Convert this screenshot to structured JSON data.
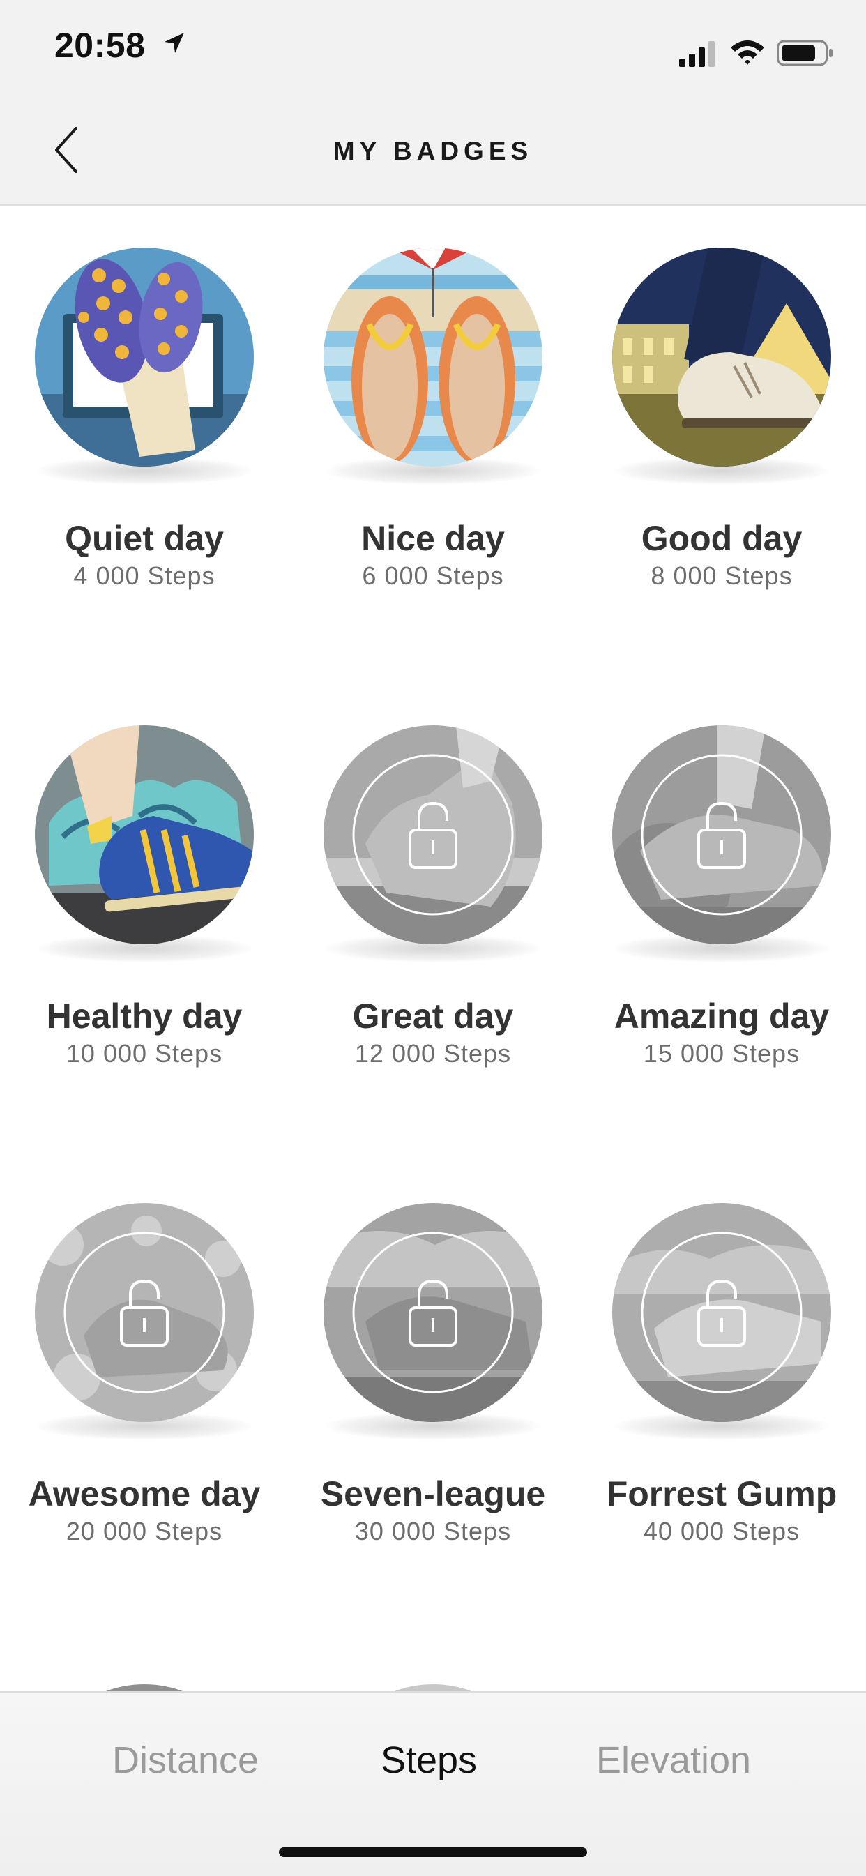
{
  "status_bar": {
    "time": "20:58",
    "icons": [
      "location-arrow-icon",
      "cellular-signal-icon",
      "wifi-icon",
      "battery-icon"
    ]
  },
  "header": {
    "title": "MY BADGES",
    "back_icon": "chevron-left-icon"
  },
  "badges": [
    {
      "name": "Quiet day",
      "steps": "4 000 Steps",
      "unlocked": true,
      "art": "slippers-computer"
    },
    {
      "name": "Nice day",
      "steps": "6 000 Steps",
      "unlocked": true,
      "art": "flip-flops-beach"
    },
    {
      "name": "Good day",
      "steps": "8 000 Steps",
      "unlocked": true,
      "art": "shoe-louvre-night"
    },
    {
      "name": "Healthy day",
      "steps": "10 000 Steps",
      "unlocked": true,
      "art": "sneaker-graffiti"
    },
    {
      "name": "Great day",
      "steps": "12 000 Steps",
      "unlocked": false,
      "art": "locked"
    },
    {
      "name": "Amazing day",
      "steps": "15 000 Steps",
      "unlocked": false,
      "art": "locked"
    },
    {
      "name": "Awesome day",
      "steps": "20 000 Steps",
      "unlocked": false,
      "art": "locked"
    },
    {
      "name": "Seven-league",
      "steps": "30 000 Steps",
      "unlocked": false,
      "art": "locked"
    },
    {
      "name": "Forrest Gump",
      "steps": "40 000 Steps",
      "unlocked": false,
      "art": "locked"
    }
  ],
  "tabs": [
    {
      "label": "Distance",
      "active": false
    },
    {
      "label": "Steps",
      "active": true
    },
    {
      "label": "Elevation",
      "active": false
    }
  ],
  "colors": {
    "header_bg": "#f2f2f2",
    "active_tab": "#111111",
    "inactive_tab": "#9a9a9a",
    "locked_badge": "#9e9e9e"
  }
}
